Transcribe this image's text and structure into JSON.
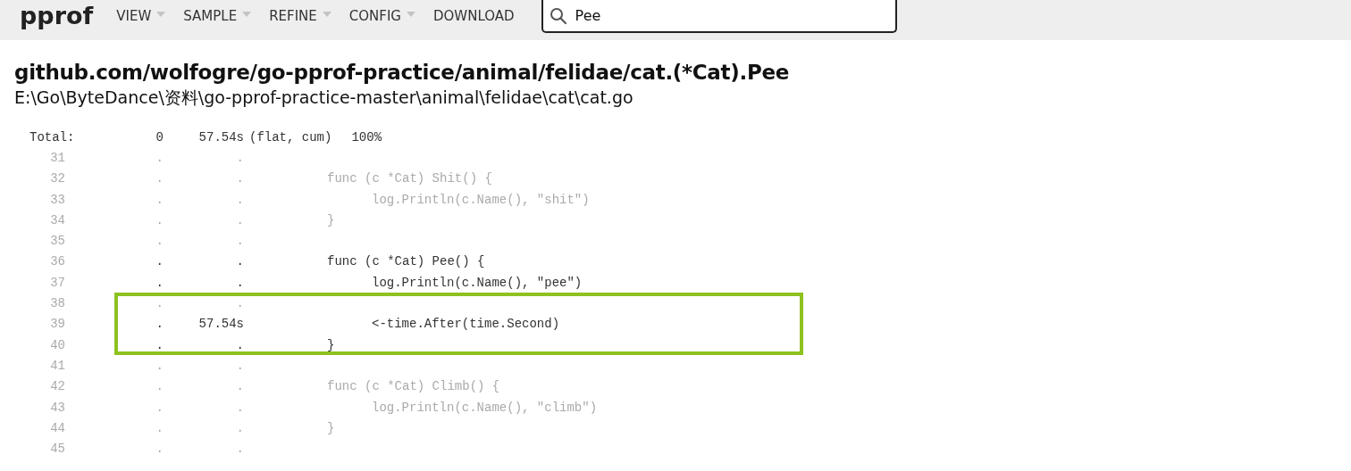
{
  "header": {
    "logo": "pprof",
    "menu": [
      {
        "label": "VIEW",
        "dropdown": true
      },
      {
        "label": "SAMPLE",
        "dropdown": true
      },
      {
        "label": "REFINE",
        "dropdown": true
      },
      {
        "label": "CONFIG",
        "dropdown": true
      },
      {
        "label": "DOWNLOAD",
        "dropdown": false
      }
    ],
    "search": {
      "value": "Pee"
    }
  },
  "function": {
    "name": "github.com/wolfogre/go-pprof-practice/animal/felidae/cat.(*Cat).Pee",
    "file": "E:\\Go\\ByteDance\\资料\\go-pprof-practice-master\\animal\\felidae\\cat\\cat.go"
  },
  "total": {
    "label": "Total:",
    "flat": "0",
    "cum": "57.54s",
    "columns": "(flat, cum)",
    "percent": "100%"
  },
  "lines": [
    {
      "number": "31",
      "flat": ".",
      "cum": ".",
      "hot": false,
      "highlighted": false
    },
    {
      "number": "32",
      "flat": ".",
      "cum": ".",
      "code": "func (c *Cat) Shit() {",
      "hot": false,
      "highlighted": false
    },
    {
      "number": "33",
      "flat": ".",
      "cum": ".",
      "code": "\tlog.Println(c.Name(), \"shit\")",
      "hot": false,
      "highlighted": false
    },
    {
      "number": "34",
      "flat": ".",
      "cum": ".",
      "code": "}",
      "hot": false,
      "highlighted": false
    },
    {
      "number": "35",
      "flat": ".",
      "cum": ".",
      "hot": false,
      "highlighted": false
    },
    {
      "number": "36",
      "flat": ".",
      "cum": ".",
      "code": "func (c *Cat) Pee() {",
      "hot": true,
      "highlighted": false
    },
    {
      "number": "37",
      "flat": ".",
      "cum": ".",
      "code": "\tlog.Println(c.Name(), \"pee\")",
      "hot": true,
      "highlighted": false
    },
    {
      "number": "38",
      "flat": ".",
      "cum": ".",
      "hot": false,
      "highlighted": true
    },
    {
      "number": "39",
      "flat": ".",
      "cum": "57.54s",
      "code": "\t<-time.After(time.Second)",
      "hot": true,
      "highlighted": true
    },
    {
      "number": "40",
      "flat": ".",
      "cum": ".",
      "code": "}",
      "hot": true,
      "highlighted": true
    },
    {
      "number": "41",
      "flat": ".",
      "cum": ".",
      "hot": false,
      "highlighted": false
    },
    {
      "number": "42",
      "flat": ".",
      "cum": ".",
      "code": "func (c *Cat) Climb() {",
      "hot": false,
      "highlighted": false
    },
    {
      "number": "43",
      "flat": ".",
      "cum": ".",
      "code": "\tlog.Println(c.Name(), \"climb\")",
      "hot": false,
      "highlighted": false
    },
    {
      "number": "44",
      "flat": ".",
      "cum": ".",
      "code": "}",
      "hot": false,
      "highlighted": false
    },
    {
      "number": "45",
      "flat": ".",
      "cum": ".",
      "hot": false,
      "highlighted": false
    }
  ]
}
